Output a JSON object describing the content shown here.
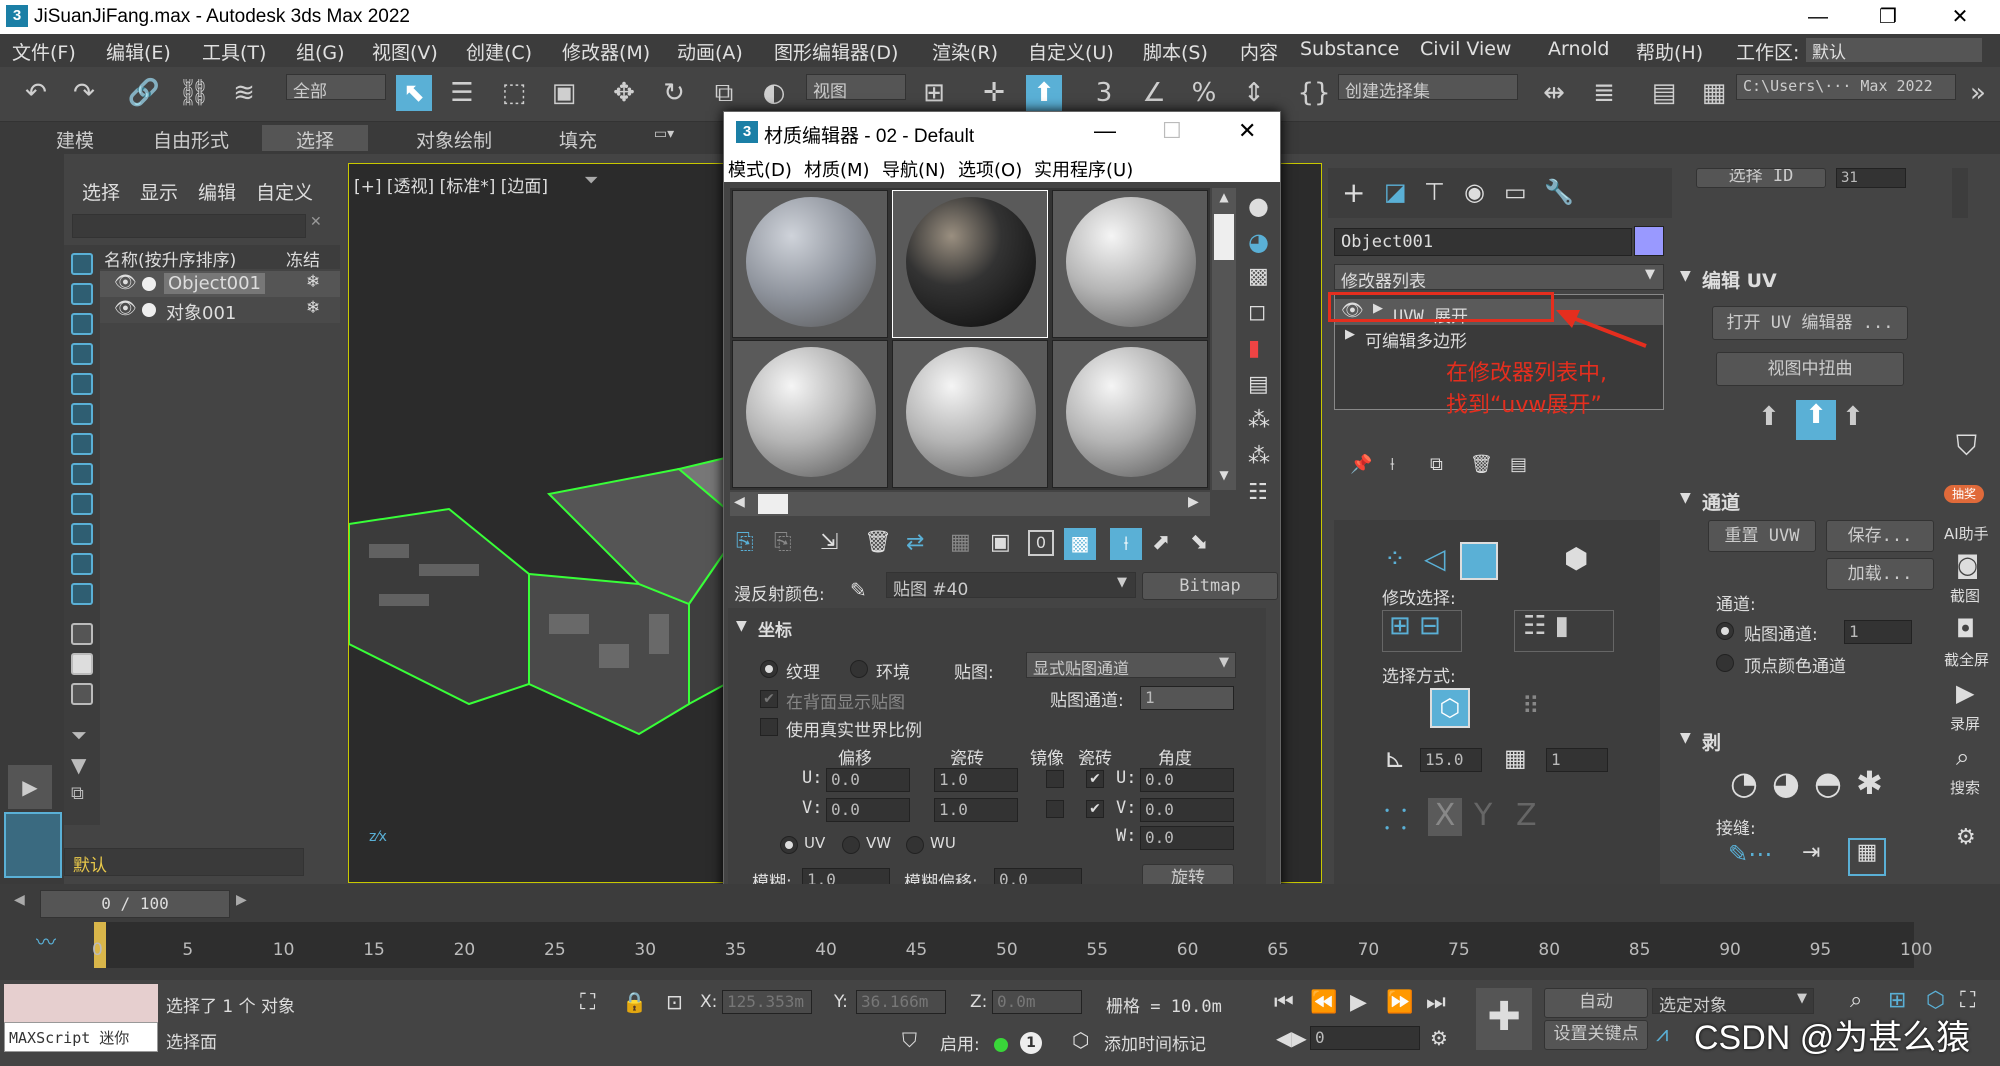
{
  "window": {
    "title": "JiSuanJiFang.max - Autodesk 3ds Max 2022",
    "icon_text": "3"
  },
  "menubar": [
    "文件(F)",
    "编辑(E)",
    "工具(T)",
    "组(G)",
    "视图(V)",
    "创建(C)",
    "修改器(M)",
    "动画(A)",
    "图形编辑器(D)",
    "渲染(R)",
    "自定义(U)",
    "脚本(S)",
    "内容",
    "Substance",
    "Civil View",
    "Arnold",
    "帮助(H)"
  ],
  "workspace": {
    "label": "工作区:",
    "value": "默认"
  },
  "toolbar": {
    "filter": "全部",
    "refcoord": "视图",
    "selset": "创建选择集",
    "path": "C:\\Users\\··· Max 2022"
  },
  "ribbon": [
    "建模",
    "自由形式",
    "选择",
    "对象绘制",
    "填充"
  ],
  "scene_explorer": {
    "menu": [
      "选择",
      "显示",
      "编辑",
      "自定义"
    ],
    "col_name": "名称(按升序排序)",
    "col_freeze": "冻结",
    "rows": [
      "Object001",
      "对象001"
    ],
    "layer": "默认"
  },
  "viewport": {
    "label": "[+] [透视] [标准*] [边面]"
  },
  "material_editor": {
    "title": "材质编辑器 - 02 - Default",
    "menu": [
      "模式(D)",
      "材质(M)",
      "导航(N)",
      "选项(O)",
      "实用程序(U)"
    ],
    "diffuse_label": "漫反射颜色:",
    "map_name": "贴图 #40",
    "map_type": "Bitmap",
    "section": "坐标",
    "radio_texture": "纹理",
    "radio_env": "环境",
    "map_label": "贴图:",
    "map_mode": "显式贴图通道",
    "show_back": "在背面显示贴图",
    "real_world": "使用真实世界比例",
    "map_channel_label": "贴图通道:",
    "map_channel": "1",
    "hdr_offset": "偏移",
    "hdr_tiling": "瓷砖",
    "hdr_mirror": "镜像",
    "hdr_tile": "瓷砖",
    "hdr_angle": "角度",
    "u": "U:",
    "v": "V:",
    "w": "W:",
    "u_offset": "0.0",
    "v_offset": "0.0",
    "u_tiling": "1.0",
    "v_tiling": "1.0",
    "u_angle": "0.0",
    "v_angle": "0.0",
    "w_angle": "0.0",
    "uv": "UV",
    "vw": "VW",
    "wu": "WU",
    "blur_label": "模糊:",
    "blur": "1.0",
    "blur_offset_label": "模糊偏移:",
    "blur_offset": "0.0",
    "rotate": "旋转",
    "slot_number": "0"
  },
  "command_panel": {
    "object_name": "Object001",
    "modifier_list": "修改器列表",
    "stack": [
      "UVW 展开",
      "可编辑多边形"
    ],
    "annotation": "在修改器列表中,\n找到“uvw展开”",
    "select_id_btn": "选择 ID",
    "select_id_val": "31",
    "edit_uv_title": "编辑 UV",
    "open_uv_editor": "打开 UV 编辑器 ...",
    "tweak_in_view": "视图中扭曲",
    "channel_title": "通道",
    "reset_uvw": "重置 UVW",
    "save": "保存...",
    "load": "加载...",
    "channel_label": "通道:",
    "map_channel_radio": "贴图通道:",
    "map_channel_val": "1",
    "vertex_color": "顶点颜色通道",
    "modify_selection": "修改选择:",
    "selection_by": "选择方式:",
    "angle_val": "15.0",
    "count_val": "1",
    "peel_title": "剥",
    "seams_label": "接缝:"
  },
  "side_tools": [
    "AI助手",
    "截图",
    "截全屏",
    "录屏",
    "搜索"
  ],
  "side_badge": "抽奖",
  "timeline": {
    "frame": "0 / 100",
    "ticks": [
      "0",
      "5",
      "10",
      "15",
      "20",
      "25",
      "30",
      "35",
      "40",
      "45",
      "50",
      "55",
      "60",
      "65",
      "70",
      "75",
      "80",
      "85",
      "90",
      "95",
      "100"
    ]
  },
  "status": {
    "maxscript": "MAXScript 迷你",
    "selected": "选择了 1 个 对象",
    "prompt": "选择面",
    "x_label": "X:",
    "x": "125.353m",
    "y_label": "Y:",
    "y": "36.166m",
    "z_label": "Z:",
    "z": "0.0m",
    "grid": "栅格 = 10.0m",
    "enable": "启用:",
    "add_tag": "添加时间标记",
    "auto": "自动",
    "set_key": "设置关键点",
    "selected_obj": "选定对象",
    "frame_val": "0",
    "watermark": "CSDN @为甚么猿"
  }
}
